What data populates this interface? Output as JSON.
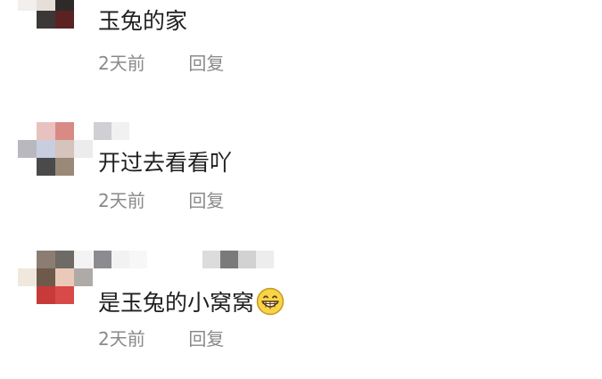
{
  "comments": [
    {
      "text": "玉兔的家",
      "time": "2天前",
      "reply_label": "回复"
    },
    {
      "text": "开过去看看吖",
      "time": "2天前",
      "reply_label": "回复"
    },
    {
      "text": "是玉兔的小窝窝",
      "emoji": "grinning-face-icon",
      "time": "2天前",
      "reply_label": "回复"
    }
  ],
  "colors": {
    "comment_text": "#1f1f1f",
    "meta_text": "#8a8a8a",
    "background": "#ffffff"
  }
}
